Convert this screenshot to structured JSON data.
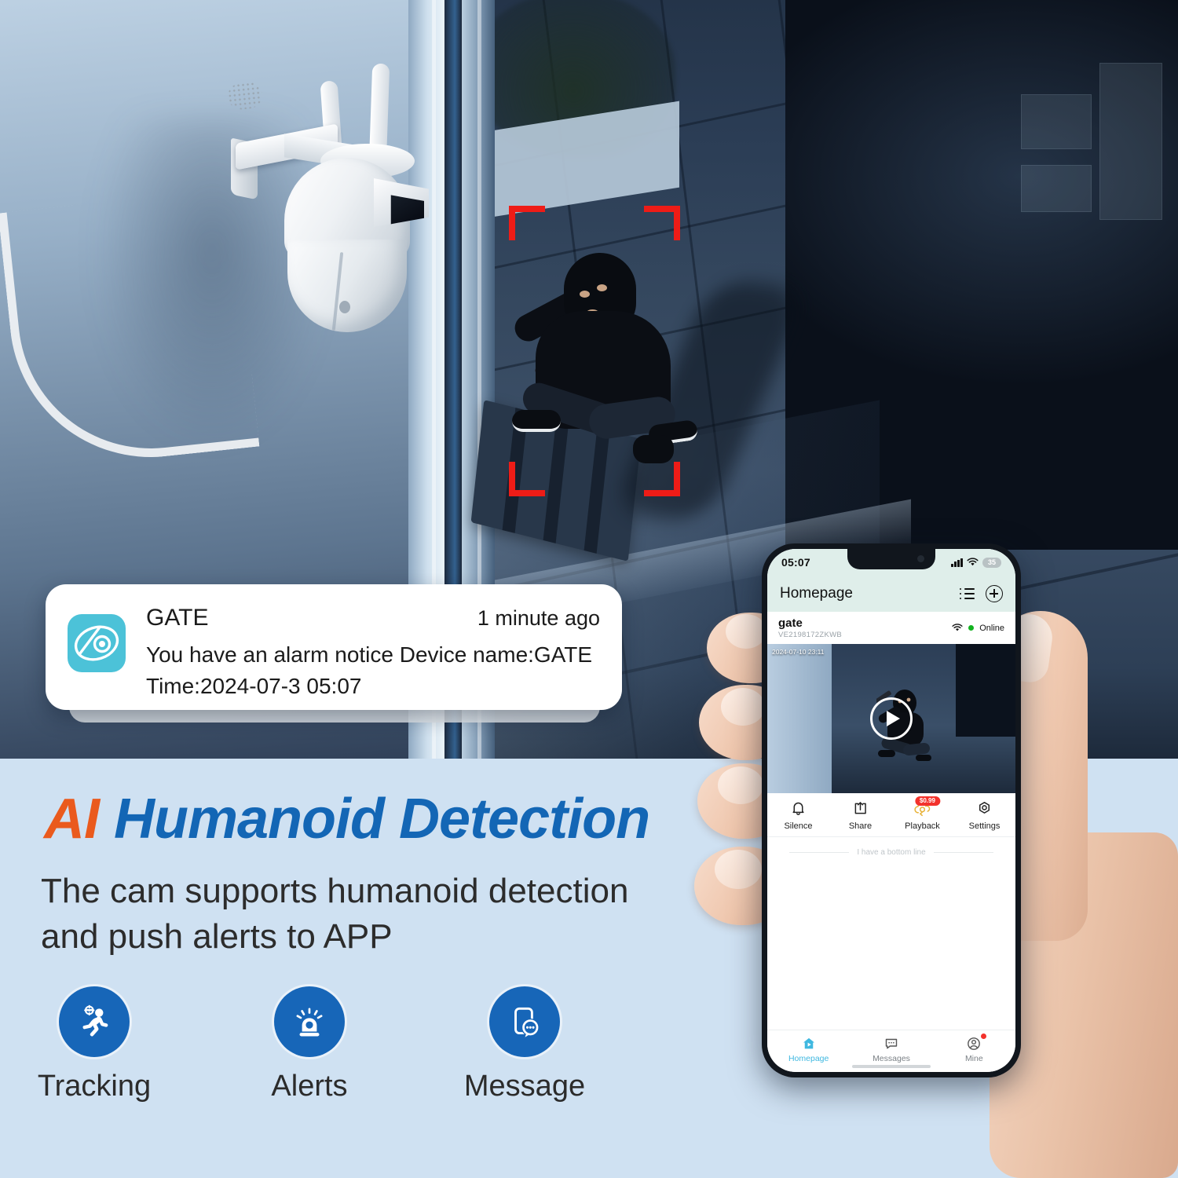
{
  "notification": {
    "app_icon": "eye-lens-app-icon",
    "title": "GATE",
    "time_ago": "1 minute ago",
    "message_line1": "You have an alarm notice Device name:GATE",
    "message_line2": "Time:2024-07-3 05:07"
  },
  "promo": {
    "headline_accent": "AI",
    "headline_main": "Humanoid Detection",
    "accent_color": "#ea5a1d",
    "main_color": "#1366b5",
    "subtitle_line1": "The cam supports humanoid detection",
    "subtitle_line2": "and push alerts to APP",
    "features": [
      {
        "icon": "running-person-tracking-icon",
        "label": "Tracking"
      },
      {
        "icon": "siren-alert-icon",
        "label": "Alerts"
      },
      {
        "icon": "phone-message-icon",
        "label": "Message"
      }
    ]
  },
  "phone": {
    "status_bar": {
      "time": "05:07",
      "signal_icon": "cellular-signal-icon",
      "wifi_icon": "wifi-icon",
      "battery_level": "35"
    },
    "header": {
      "title": "Homepage",
      "list_icon": "list-view-icon",
      "add_icon": "add-circle-icon"
    },
    "device": {
      "name": "gate",
      "id": "VE2198172ZKWB",
      "wifi_icon": "wifi-icon",
      "status": "Online",
      "status_color": "#12b21f",
      "video_timestamp": "2024-07-10 23:11",
      "play_icon": "play-button-icon"
    },
    "actions": [
      {
        "icon": "bell-silence-icon",
        "label": "Silence",
        "badge": ""
      },
      {
        "icon": "share-icon",
        "label": "Share",
        "badge": ""
      },
      {
        "icon": "cloud-playback-icon",
        "label": "Playback",
        "badge": "$0.99"
      },
      {
        "icon": "settings-gear-icon",
        "label": "Settings",
        "badge": ""
      }
    ],
    "bottom_line_text": "I have a bottom line",
    "tabs": [
      {
        "icon": "home-icon",
        "label": "Homepage",
        "active": true,
        "dot": false
      },
      {
        "icon": "message-bubble-icon",
        "label": "Messages",
        "active": false,
        "dot": false
      },
      {
        "icon": "user-profile-icon",
        "label": "Mine",
        "active": false,
        "dot": true
      }
    ]
  },
  "scene": {
    "camera_device": "outdoor-ptz-security-camera",
    "detection_box": "red-corner-brackets",
    "subject": "intruder-figure"
  }
}
